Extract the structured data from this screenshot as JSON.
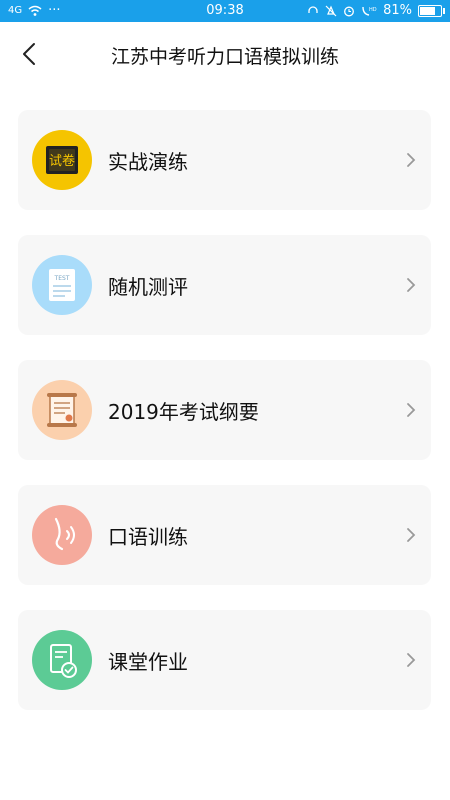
{
  "status_bar": {
    "signal": "4G",
    "dots": "···",
    "time": "09:38",
    "battery_text": "81%",
    "battery_level": 0.81
  },
  "header": {
    "title": "江苏中考听力口语模拟训练"
  },
  "menu": [
    {
      "label": "实战演练",
      "icon": "exam-paper-icon",
      "icon_text": "试卷",
      "color": "#f5c400"
    },
    {
      "label": "随机测评",
      "icon": "test-sheet-icon",
      "icon_text": "TEST",
      "color": "#a9dcfa"
    },
    {
      "label": "2019年考试纲要",
      "icon": "scroll-icon",
      "color": "#fbd0ad"
    },
    {
      "label": "口语训练",
      "icon": "speaking-icon",
      "color": "#f5aa9c"
    },
    {
      "label": "课堂作业",
      "icon": "homework-icon",
      "color": "#5ccb95"
    }
  ]
}
